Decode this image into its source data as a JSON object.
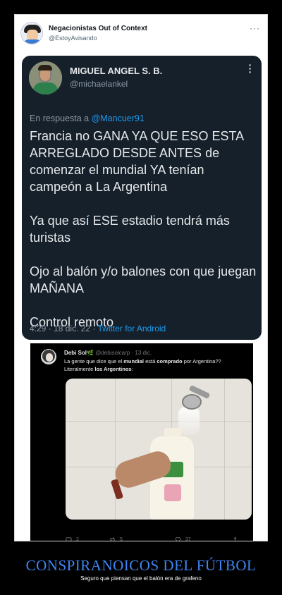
{
  "outer_tweet": {
    "name": "Negacionistas Out of Context",
    "handle": "@EstoyAvisando",
    "more": "···"
  },
  "quoted_tweet": {
    "name": "MIGUEL ANGEL S. B.",
    "handle": "@michaelankel",
    "reply_prefix": "En respuesta a ",
    "reply_mention": "@Mancuer91",
    "paragraphs": [
      "Francia no GANA YA QUE ESO ESTA ARREGLADO DESDE ANTES de comenzar el mundial YA tenían campeón a La Argentina",
      "Ya que así ESE estadio tendrá más turistas",
      "Ojo al balón y/o balones con que juegan MAÑANA",
      "Control remoto"
    ],
    "time_date": "4:29 · 18 dic. 22 · ",
    "source": "Twitter for Android"
  },
  "screenshot_tweet": {
    "name": "Debi Sol",
    "leaf": "🌿",
    "handle_date": " @debisolcarp · 13 dic.",
    "text_1": "La gente que dice que el ",
    "text_bold_1": "mundial",
    "text_2": " está ",
    "text_bold_2": "comprado",
    "text_3": " por Argentina??",
    "text_4": "Literalmente ",
    "text_bold_3": "los Argentinos",
    "text_5": ":",
    "replies": "2",
    "retweets": "5",
    "likes": "37"
  },
  "caption": {
    "title": "CONSPIRANOICOS DEL FÚTBOL",
    "subtitle": "Seguro que piensan que el balón era de grafeno"
  }
}
